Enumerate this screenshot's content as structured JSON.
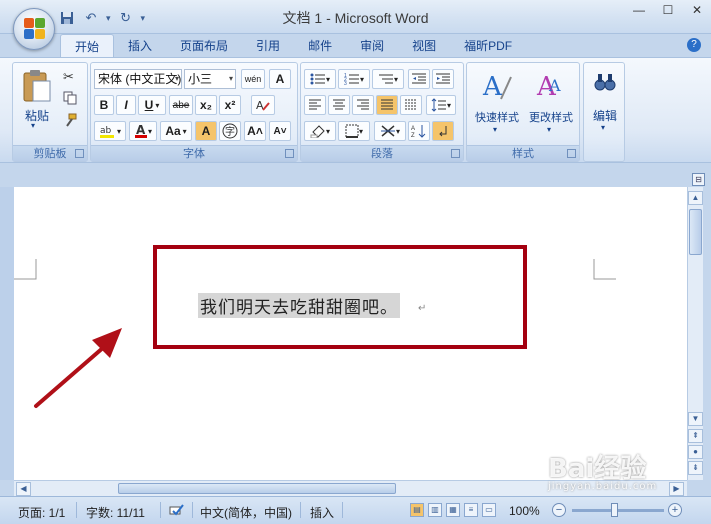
{
  "window": {
    "title": "文档 1 - Microsoft Word"
  },
  "quick_access": {
    "save_icon": "save-icon",
    "undo_icon": "undo-icon",
    "redo_icon": "redo-icon"
  },
  "tabs": [
    {
      "label": "开始",
      "active": true
    },
    {
      "label": "插入"
    },
    {
      "label": "页面布局"
    },
    {
      "label": "引用"
    },
    {
      "label": "邮件"
    },
    {
      "label": "审阅"
    },
    {
      "label": "视图"
    },
    {
      "label": "福昕PDF"
    }
  ],
  "ribbon": {
    "clipboard": {
      "label": "剪贴板",
      "paste": "粘贴"
    },
    "font": {
      "label": "字体",
      "font_name": "宋体 (中文正文)",
      "font_size": "小三",
      "wen": "wén",
      "bold": "B",
      "italic": "I",
      "underline": "U",
      "strike": "abe",
      "sub": "x₂",
      "sup": "x²",
      "aa": "Aa",
      "grow": "A˄",
      "shrink": "A˅"
    },
    "paragraph": {
      "label": "段落"
    },
    "styles": {
      "label": "样式",
      "quick_styles": "快速样式",
      "change_styles": "更改样式"
    },
    "editing": {
      "label": "编辑"
    }
  },
  "document": {
    "text": "我们明天去吃甜甜圈吧。",
    "para_mark": "↵"
  },
  "status": {
    "page": "页面: 1/1",
    "words": "字数: 11/11",
    "language": "中文(简体，中国)",
    "mode": "插入",
    "zoom": "100%"
  },
  "watermark": {
    "brand": "Bai经验",
    "site": "jingyan.baidu.com"
  },
  "colors": {
    "highlight_box": "#a40010",
    "arrow": "#b01018"
  }
}
